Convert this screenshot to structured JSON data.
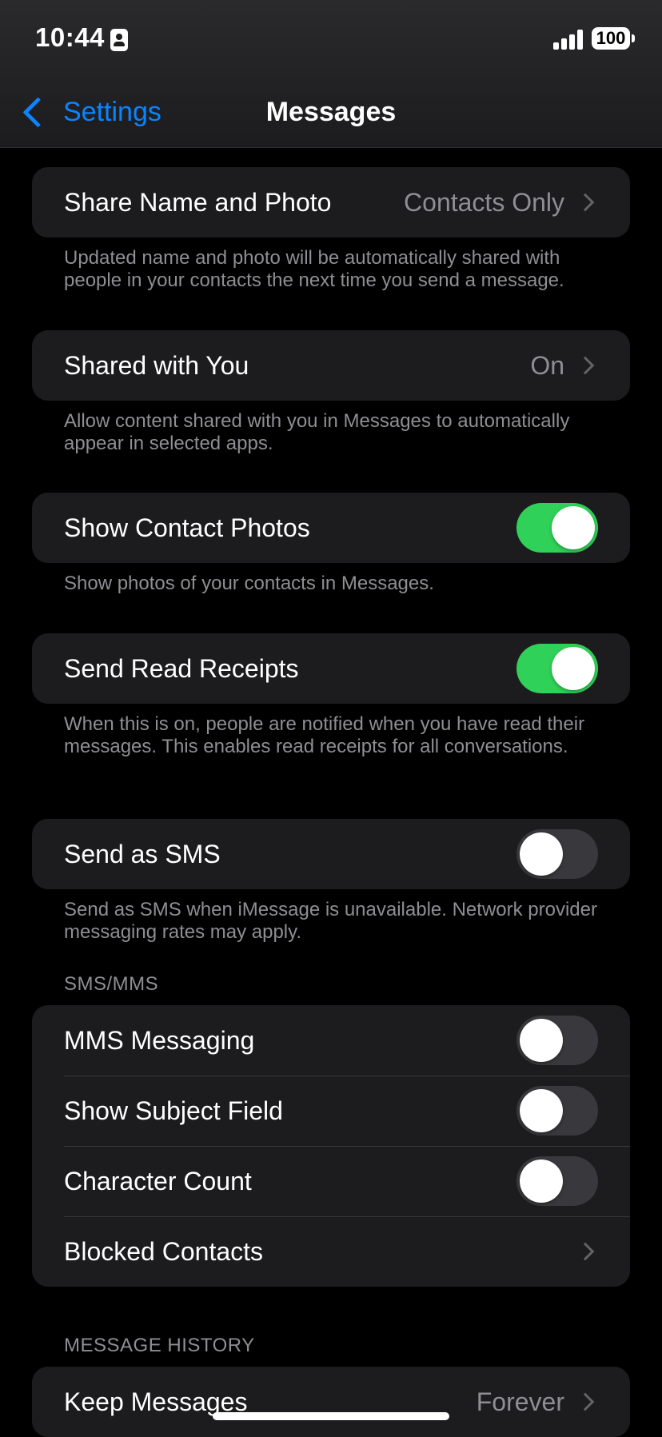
{
  "status_bar": {
    "time": "10:44",
    "battery": "100"
  },
  "nav": {
    "back_label": "Settings",
    "title": "Messages"
  },
  "groups": {
    "share_name": {
      "label": "Share Name and Photo",
      "value": "Contacts Only",
      "footer": "Updated name and photo will be automatically shared with people in your contacts the next time you send a message."
    },
    "shared_with_you": {
      "label": "Shared with You",
      "value": "On",
      "footer": "Allow content shared with you in Messages to automatically appear in selected apps."
    },
    "contact_photos": {
      "label": "Show Contact Photos",
      "on": true,
      "footer": "Show photos of your contacts in Messages."
    },
    "read_receipts": {
      "label": "Send Read Receipts",
      "on": true,
      "footer": "When this is on, people are notified when you have read their messages. This enables read receipts for all conversations."
    },
    "send_sms": {
      "label": "Send as SMS",
      "on": false,
      "footer": "Send as SMS when iMessage is unavailable. Network provider messaging rates may apply."
    }
  },
  "sms_mms": {
    "header": "SMS/MMS",
    "mms_messaging": {
      "label": "MMS Messaging",
      "on": false
    },
    "subject_field": {
      "label": "Show Subject Field",
      "on": false
    },
    "character_count": {
      "label": "Character Count",
      "on": false
    },
    "blocked_contacts": {
      "label": "Blocked Contacts"
    }
  },
  "message_history": {
    "header": "MESSAGE HISTORY",
    "keep_messages": {
      "label": "Keep Messages",
      "value": "Forever"
    }
  },
  "colors": {
    "accent": "#0a84ff",
    "toggle_on": "#30d158",
    "toggle_off": "#39393d",
    "cell_background": "#1c1c1e"
  }
}
